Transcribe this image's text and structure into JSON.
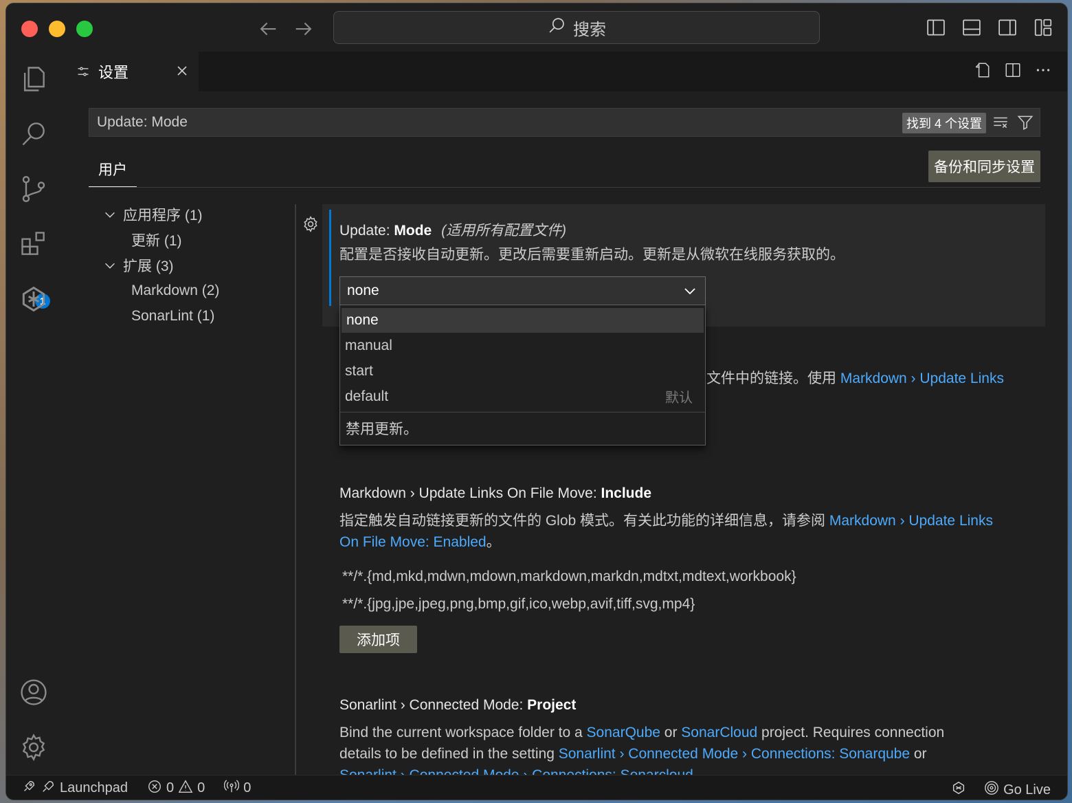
{
  "search": {
    "label": "搜索"
  },
  "tab": {
    "label": "设置"
  },
  "settings_search": {
    "value": "Update: Mode",
    "found": "找到 4 个设置"
  },
  "scope_tab": "用户",
  "sync_button": "备份和同步设置",
  "tree": [
    {
      "label": "应用程序 (1)"
    },
    {
      "label": "更新 (1)"
    },
    {
      "label": "扩展 (3)"
    },
    {
      "label": "Markdown (2)"
    },
    {
      "label": "SonarLint (1)"
    }
  ],
  "activity_badge": "1",
  "setting1": {
    "category": "Update: ",
    "name": "Mode",
    "scope": "(适用所有配置文件)",
    "description": "配置是否接收自动更新。更改后需要重新启动。更新是从微软在线服务获取的。",
    "value": "none",
    "options": [
      "none",
      "manual",
      "start",
      "default"
    ],
    "default_label": "默认",
    "option_description": "禁用更新。"
  },
  "setting2_partial": {
    "text": "文件中的链接。使用 ",
    "link": "Markdown › Update Links"
  },
  "setting3": {
    "category": "Markdown › Update Links On File Move: ",
    "name": "Include",
    "desc_text": "指定触发自动链接更新的文件的 Glob 模式。有关此功能的详细信息，请参阅 ",
    "desc_link1": "Markdown › Update Links",
    "desc_link2": "On File Move: Enabled",
    "desc_end": "。",
    "items": [
      "**/*.{md,mkd,mdwn,mdown,markdown,markdn,mdtxt,mdtext,workbook}",
      "**/*.{jpg,jpe,jpeg,png,bmp,gif,ico,webp,avif,tiff,svg,mp4}"
    ],
    "add_button": "添加项"
  },
  "setting4": {
    "category": "Sonarlint › Connected Mode: ",
    "name": "Project",
    "t1": "Bind the current workspace folder to a ",
    "l1": "SonarQube",
    "t2": " or ",
    "l2": "SonarCloud",
    "t3": " project. Requires connection",
    "t4": "details to be defined in the setting ",
    "l3": "Sonarlint › Connected Mode › Connections: Sonarqube",
    "t5": " or",
    "l4": "Sonarlint › Connected Mode › Connections: Sonarcloud"
  },
  "statusbar": {
    "launchpad": "Launchpad",
    "errors": "0",
    "warnings": "0",
    "ports": "0",
    "golive": "Go Live"
  },
  "colors": {
    "accent": "#0078d4",
    "link": "#4daafc",
    "badge": "#0078d4"
  }
}
